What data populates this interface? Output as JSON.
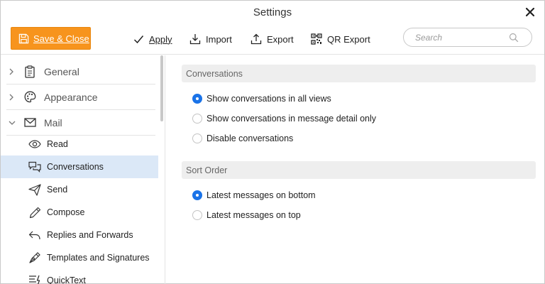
{
  "window": {
    "title": "Settings"
  },
  "toolbar": {
    "save_label": "Save & Close",
    "apply_label": "Apply",
    "import_label": "Import",
    "export_label": "Export",
    "qr_export_label": "QR Export",
    "search_placeholder": "Search",
    "search_value": ""
  },
  "sidebar": {
    "sections": [
      {
        "label": "General",
        "icon": "clipboard-icon",
        "expanded": false
      },
      {
        "label": "Appearance",
        "icon": "palette-icon",
        "expanded": false
      },
      {
        "label": "Mail",
        "icon": "envelope-icon",
        "expanded": true
      }
    ],
    "mail_items": [
      {
        "label": "Read",
        "icon": "eye-icon",
        "selected": false
      },
      {
        "label": "Conversations",
        "icon": "chat-bubbles-icon",
        "selected": true
      },
      {
        "label": "Send",
        "icon": "paper-plane-icon",
        "selected": false
      },
      {
        "label": "Compose",
        "icon": "pencil-icon",
        "selected": false
      },
      {
        "label": "Replies and Forwards",
        "icon": "reply-icon",
        "selected": false
      },
      {
        "label": "Templates and Signatures",
        "icon": "pen-nib-icon",
        "selected": false
      },
      {
        "label": "QuickText",
        "icon": "quicktext-icon",
        "selected": false
      }
    ]
  },
  "content": {
    "groups": [
      {
        "title": "Conversations",
        "options": [
          {
            "label": "Show conversations in all views",
            "checked": true
          },
          {
            "label": "Show conversations in message detail only",
            "checked": false
          },
          {
            "label": "Disable conversations",
            "checked": false
          }
        ]
      },
      {
        "title": "Sort Order",
        "options": [
          {
            "label": "Latest messages on bottom",
            "checked": true
          },
          {
            "label": "Latest messages on top",
            "checked": false
          }
        ]
      }
    ]
  },
  "colors": {
    "accent_orange": "#f7941d",
    "radio_blue": "#1a73e8",
    "selected_row": "#dbe8f7"
  }
}
